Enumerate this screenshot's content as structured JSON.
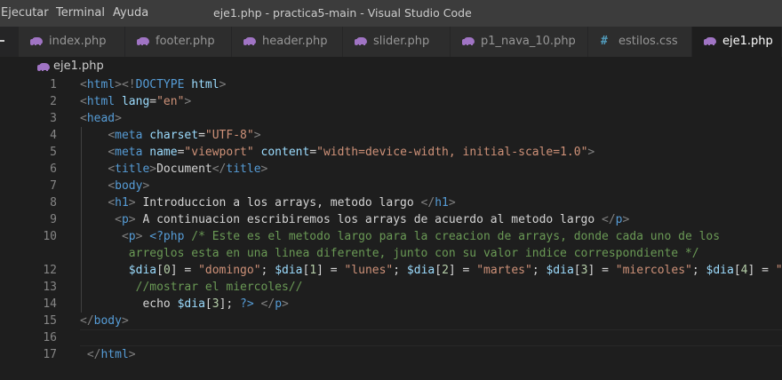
{
  "menu": [
    {
      "label": "Ejecutar"
    },
    {
      "label": "Terminal"
    },
    {
      "label": "Ayuda"
    }
  ],
  "window_title": "eje1.php - practica5-main - Visual Studio Code",
  "tabs": [
    {
      "label": "index.php",
      "icon": "php-elephant-icon",
      "active": false
    },
    {
      "label": "footer.php",
      "icon": "php-elephant-icon",
      "active": false
    },
    {
      "label": "header.php",
      "icon": "php-elephant-icon",
      "active": false
    },
    {
      "label": "slider.php",
      "icon": "php-elephant-icon",
      "active": false
    },
    {
      "label": "p1_nava_10.php",
      "icon": "php-elephant-icon",
      "active": false
    },
    {
      "label": "estilos.css",
      "icon": "css-hash-icon",
      "active": false
    },
    {
      "label": "eje1.php",
      "icon": "php-elephant-icon",
      "active": true
    }
  ],
  "css_icon_glyph": "#",
  "breadcrumb": {
    "file": "eje1.php",
    "icon": "php-elephant-icon"
  },
  "colors": {
    "titlebar": "#3c3c3c",
    "tabbar": "#252526",
    "tab_inactive": "#2d2d2d",
    "editor_bg": "#1e1e1e",
    "tag": "#569cd6",
    "attribute": "#9cdcfe",
    "string": "#ce9178",
    "comment": "#6a9955",
    "php_icon": "#a074c4",
    "css_icon": "#519aba"
  },
  "editor": {
    "lines": [
      {
        "n": "1",
        "tokens": [
          [
            "t-br",
            "<"
          ],
          [
            "t-tag",
            "html"
          ],
          [
            "t-br",
            "><!"
          ],
          [
            "t-tag",
            "DOCTYPE"
          ],
          [
            "t-txt",
            " "
          ],
          [
            "t-attr",
            "html"
          ],
          [
            "t-br",
            ">"
          ]
        ]
      },
      {
        "n": "2",
        "tokens": [
          [
            "t-br",
            "<"
          ],
          [
            "t-tag",
            "html"
          ],
          [
            "t-txt",
            " "
          ],
          [
            "t-attr",
            "lang"
          ],
          [
            "t-txt",
            "="
          ],
          [
            "t-str",
            "\"en\""
          ],
          [
            "t-br",
            ">"
          ]
        ]
      },
      {
        "n": "3",
        "tokens": [
          [
            "t-br",
            "<"
          ],
          [
            "t-tag",
            "head"
          ],
          [
            "t-br",
            ">"
          ]
        ]
      },
      {
        "n": "4",
        "tokens": [
          [
            "t-txt",
            "    "
          ],
          [
            "t-br",
            "<"
          ],
          [
            "t-tag",
            "meta"
          ],
          [
            "t-txt",
            " "
          ],
          [
            "t-attr",
            "charset"
          ],
          [
            "t-txt",
            "="
          ],
          [
            "t-str",
            "\"UTF-8\""
          ],
          [
            "t-br",
            ">"
          ]
        ]
      },
      {
        "n": "5",
        "tokens": [
          [
            "t-txt",
            "    "
          ],
          [
            "t-br",
            "<"
          ],
          [
            "t-tag",
            "meta"
          ],
          [
            "t-txt",
            " "
          ],
          [
            "t-attr",
            "name"
          ],
          [
            "t-txt",
            "="
          ],
          [
            "t-str",
            "\"viewport\""
          ],
          [
            "t-txt",
            " "
          ],
          [
            "t-attr",
            "content"
          ],
          [
            "t-txt",
            "="
          ],
          [
            "t-str",
            "\"width=device-width, initial-scale=1.0\""
          ],
          [
            "t-br",
            ">"
          ]
        ]
      },
      {
        "n": "6",
        "tokens": [
          [
            "t-txt",
            "    "
          ],
          [
            "t-br",
            "<"
          ],
          [
            "t-tag",
            "title"
          ],
          [
            "t-br",
            ">"
          ],
          [
            "t-txt",
            "Document"
          ],
          [
            "t-br",
            "</"
          ],
          [
            "t-tag",
            "title"
          ],
          [
            "t-br",
            ">"
          ]
        ]
      },
      {
        "n": "7",
        "tokens": [
          [
            "t-txt",
            "    "
          ],
          [
            "t-br",
            "<"
          ],
          [
            "t-tag",
            "body"
          ],
          [
            "t-br",
            ">"
          ]
        ]
      },
      {
        "n": "8",
        "tokens": [
          [
            "t-txt",
            "    "
          ],
          [
            "t-br",
            "<"
          ],
          [
            "t-tag",
            "h1"
          ],
          [
            "t-br",
            ">"
          ],
          [
            "t-txt",
            " Introduccion a los arrays, metodo largo "
          ],
          [
            "t-br",
            "</"
          ],
          [
            "t-tag",
            "h1"
          ],
          [
            "t-br",
            ">"
          ]
        ]
      },
      {
        "n": "9",
        "tokens": [
          [
            "t-txt",
            "     "
          ],
          [
            "t-br",
            "<"
          ],
          [
            "t-tag",
            "p"
          ],
          [
            "t-br",
            ">"
          ],
          [
            "t-txt",
            " A continuacion escribiremos los arrays de acuerdo al metodo largo "
          ],
          [
            "t-br",
            "</"
          ],
          [
            "t-tag",
            "p"
          ],
          [
            "t-br",
            ">"
          ]
        ]
      },
      {
        "n": "10",
        "tokens": [
          [
            "t-txt",
            "      "
          ],
          [
            "t-br",
            "<"
          ],
          [
            "t-tag",
            "p"
          ],
          [
            "t-br",
            ">"
          ],
          [
            "t-txt",
            " "
          ],
          [
            "t-php",
            "<?php"
          ],
          [
            "t-txt",
            " "
          ],
          [
            "t-com",
            "/* Este es el metodo largo para la creacion de arrays, donde cada uno de los"
          ]
        ]
      },
      {
        "n": "",
        "tokens": [
          [
            "t-txt",
            "       "
          ],
          [
            "t-com",
            "arreglos esta en una linea diferente, junto con su valor indice correspondiente */"
          ]
        ]
      },
      {
        "n": "12",
        "tokens": [
          [
            "t-txt",
            "       "
          ],
          [
            "t-var",
            "$dia"
          ],
          [
            "t-txt",
            "["
          ],
          [
            "t-num",
            "0"
          ],
          [
            "t-txt",
            "] = "
          ],
          [
            "t-str",
            "\"domingo\""
          ],
          [
            "t-txt",
            "; "
          ],
          [
            "t-var",
            "$dia"
          ],
          [
            "t-txt",
            "["
          ],
          [
            "t-num",
            "1"
          ],
          [
            "t-txt",
            "] = "
          ],
          [
            "t-str",
            "\"lunes\""
          ],
          [
            "t-txt",
            "; "
          ],
          [
            "t-var",
            "$dia"
          ],
          [
            "t-txt",
            "["
          ],
          [
            "t-num",
            "2"
          ],
          [
            "t-txt",
            "] = "
          ],
          [
            "t-str",
            "\"martes\""
          ],
          [
            "t-txt",
            "; "
          ],
          [
            "t-var",
            "$dia"
          ],
          [
            "t-txt",
            "["
          ],
          [
            "t-num",
            "3"
          ],
          [
            "t-txt",
            "] = "
          ],
          [
            "t-str",
            "\"miercoles\""
          ],
          [
            "t-txt",
            "; "
          ],
          [
            "t-var",
            "$dia"
          ],
          [
            "t-txt",
            "["
          ],
          [
            "t-num",
            "4"
          ],
          [
            "t-txt",
            "] = "
          ],
          [
            "t-str",
            "\"ju"
          ]
        ]
      },
      {
        "n": "13",
        "tokens": [
          [
            "t-txt",
            "        "
          ],
          [
            "t-com",
            "//mostrar el miercoles//"
          ]
        ]
      },
      {
        "n": "14",
        "tokens": [
          [
            "t-txt",
            "         "
          ],
          [
            "t-txt",
            "echo "
          ],
          [
            "t-var",
            "$dia"
          ],
          [
            "t-txt",
            "["
          ],
          [
            "t-num",
            "3"
          ],
          [
            "t-txt",
            "]; "
          ],
          [
            "t-php",
            "?>"
          ],
          [
            "t-txt",
            " "
          ],
          [
            "t-br",
            "</"
          ],
          [
            "t-tag",
            "p"
          ],
          [
            "t-br",
            ">"
          ]
        ]
      },
      {
        "n": "15",
        "tokens": [
          [
            "t-br",
            "</"
          ],
          [
            "t-tag",
            "body"
          ],
          [
            "t-br",
            ">"
          ]
        ]
      },
      {
        "n": "16",
        "tokens": []
      },
      {
        "n": "17",
        "tokens": [
          [
            "t-txt",
            " "
          ],
          [
            "t-br",
            "</"
          ],
          [
            "t-tag",
            "html"
          ],
          [
            "t-br",
            ">"
          ]
        ]
      }
    ]
  }
}
